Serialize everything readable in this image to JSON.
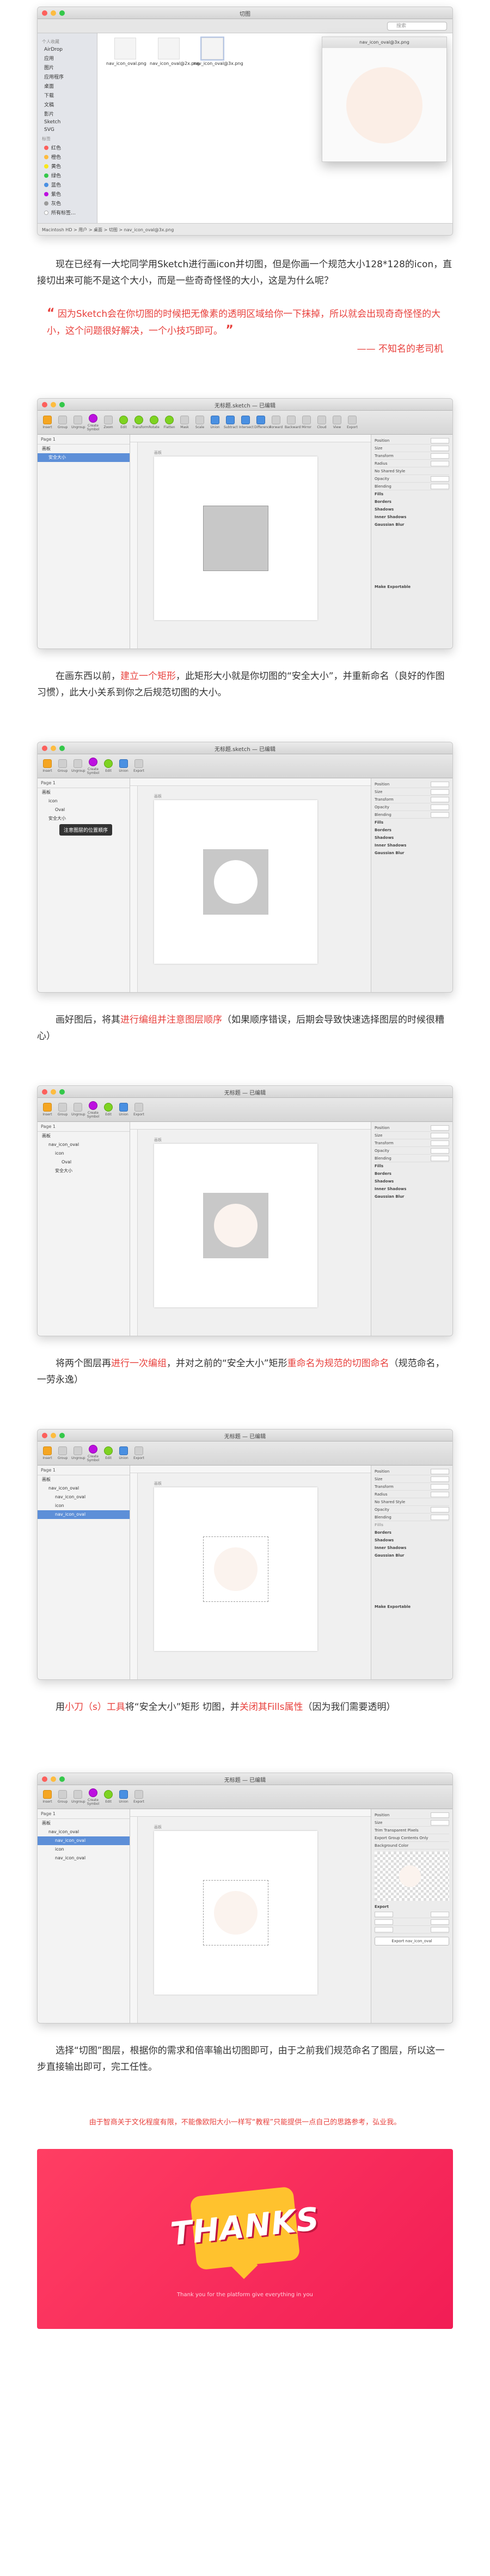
{
  "finder": {
    "window_title": "切图",
    "search_placeholder": "搜索",
    "sidebar_head_fav": "个人收藏",
    "sidebar_items": [
      "AirDrop",
      "应用",
      "图片",
      "应用程序",
      "桌面",
      "下载",
      "文稿",
      "影片",
      "Sketch",
      "SVG"
    ],
    "sidebar_head_tags": "标签",
    "tags": [
      {
        "label": "红色",
        "color": "#fc605c"
      },
      {
        "label": "橙色",
        "color": "#fdbc40"
      },
      {
        "label": "黄色",
        "color": "#f8e71c"
      },
      {
        "label": "绿色",
        "color": "#34c84a"
      },
      {
        "label": "蓝色",
        "color": "#4a90e2"
      },
      {
        "label": "紫色",
        "color": "#bd10e0"
      },
      {
        "label": "灰色",
        "color": "#9b9b9b"
      },
      {
        "label": "所有标签…",
        "color": "#ffffff"
      }
    ],
    "files": [
      "nav_icon_oval.png",
      "nav_icon_oval@2x.png",
      "nav_icon_oval@3x.png"
    ],
    "preview_title": "nav_icon_oval@3x.png",
    "status_path": "Macintosh HD > 用户 > 桌面 > 切图 > nav_icon_oval@3x.png"
  },
  "paragraphs": {
    "p1": "现在已经有一大坨同学用Sketch进行画icon并切图，但是你画一个规范大小128*128的icon，直接切出来可能不是这个大小，而是一些奇奇怪怪的大小，这是为什么呢？",
    "quote": "因为Sketch会在你切图的时候把无像素的透明区域给你一下抹掉，所以就会出现奇奇怪怪的大小，这个问题很好解决，一个小技巧即可。",
    "quote_sign": "—— 不知名的老司机",
    "p2_a": "在画东西以前，",
    "p2_hl": "建立一个矩形",
    "p2_b": "，此矩形大小就是你切图的“安全大小”，并重新命名（良好的作图习惯），此大小关系到你之后规范切图的大小。",
    "p3_a": "画好图后，将其",
    "p3_hl": "进行编组并注意图层顺序",
    "p3_b": "（如果顺序错误，后期会导致快速选择图层的时候很糟心）",
    "p4_a": "将两个图层再",
    "p4_hl1": "进行一次编组",
    "p4_b": "，并对之前的“安全大小”矩形",
    "p4_hl2": "重命名为规范的切图命名",
    "p4_c": "（规范命名，一劳永逸）",
    "p5_a": "用",
    "p5_hl1": "小刀（s）工具",
    "p5_b": "将“安全大小”矩形 切图，并",
    "p5_hl2": "关闭其Fills属性",
    "p5_c": "（因为我们需要透明）",
    "p6": "选择“切图”图层，根据你的需求和倍率输出切图即可，由于之前我们规范命名了图层，所以这一步直接输出即可，完工任性。",
    "note": "由于智商关于文化程度有限，不能像欧阳大小一样写“教程”只能提供一点自己的思路参考，弘业我。"
  },
  "sketch": {
    "title_1": "无标题 — 已编辑",
    "title_2": "无标题.sketch — 已编辑",
    "page_label": "Page 1",
    "toolbar": [
      "Insert",
      "Group",
      "Ungroup",
      "Create Symbol",
      "Zoom",
      "Edit",
      "Transform",
      "Rotate",
      "Flatten",
      "Mask",
      "Scale",
      "Union",
      "Subtract",
      "Intersect",
      "Difference",
      "Forward",
      "Backward",
      "Mirror",
      "Cloud",
      "View",
      "Export"
    ],
    "artboard_label": "画板",
    "rulers": [
      "0",
      "100",
      "200",
      "300",
      "400"
    ],
    "inspector_rows": [
      "Position",
      "Size",
      "Transform",
      "Radius",
      "No Shared Style",
      "Opacity",
      "Blending",
      "Fills",
      "Borders",
      "Shadows",
      "Inner Shadows",
      "Gaussian Blur",
      "Make Exportable"
    ],
    "inspector_export": [
      "Trim Transparent Pixels",
      "Export Group Contents Only",
      "Background Color",
      "Export",
      "Export nav_icon_oval"
    ],
    "layers_1": [
      "画板",
      "安全大小"
    ],
    "layers_2": [
      "画板",
      "icon",
      "Oval",
      "安全大小"
    ],
    "tooltip_2": "注意图层的位置顺序",
    "layers_3": [
      "画板",
      "nav_icon_oval",
      "icon",
      "Oval",
      "安全大小"
    ],
    "layers_4": [
      "画板",
      "nav_icon_oval",
      "nav_icon_oval",
      "icon",
      "nav_icon_oval"
    ],
    "layers_5": [
      "画板",
      "nav_icon_oval",
      "nav_icon_oval",
      "icon",
      "nav_icon_oval"
    ]
  },
  "thanks": {
    "word": "THANKS",
    "sub": "Thank you for the platform give everything in you"
  }
}
